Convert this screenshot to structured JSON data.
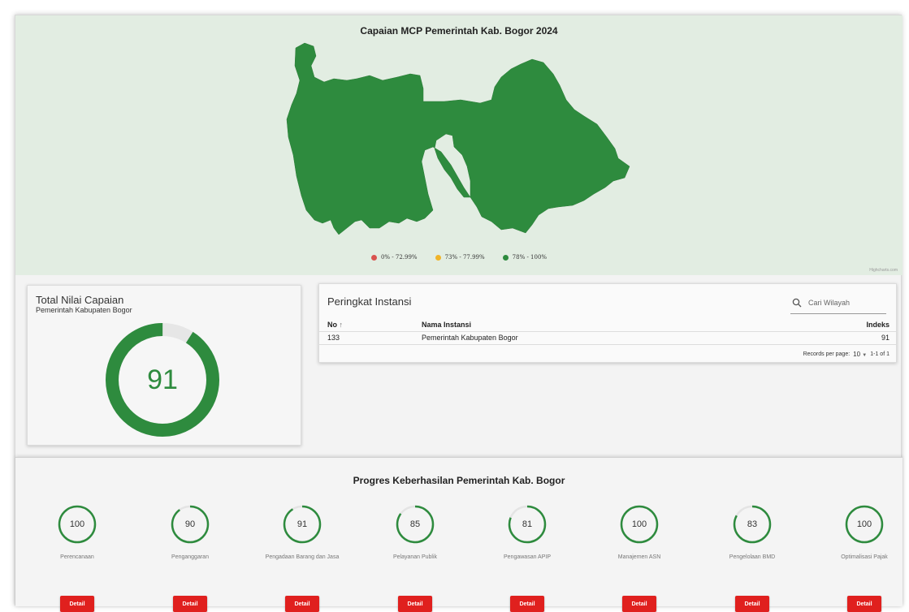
{
  "map": {
    "title": "Capaian MCP Pemerintah Kab. Bogor 2024",
    "legend": [
      {
        "label": "0% - 72.99%",
        "color": "#d9534f"
      },
      {
        "label": "73% - 77.99%",
        "color": "#f0b429"
      },
      {
        "label": "78% - 100%",
        "color": "#2e8b3e"
      }
    ],
    "region_color": "#2e8b3e",
    "credits": "Highcharts.com"
  },
  "total": {
    "title": "Total Nilai Capaian",
    "subtitle": "Pemerintah Kabupaten Bogor",
    "value": "91",
    "fraction": 0.91,
    "color": "#2e8b3e"
  },
  "ranking": {
    "title": "Peringkat Instansi",
    "search_placeholder": "Cari Wilayah",
    "columns": {
      "no": "No",
      "name": "Nama Instansi",
      "index": "Indeks"
    },
    "rows": [
      {
        "no": "133",
        "name": "Pemerintah Kabupaten Bogor",
        "index": "91"
      }
    ],
    "records_label": "Records per page:",
    "records_value": "10",
    "range": "1-1 of 1"
  },
  "progress": {
    "title": "Progres Keberhasilan Pemerintah Kab. Bogor",
    "button_label": "Detail",
    "items": [
      {
        "value": "100",
        "label": "Perencanaan",
        "fraction": 1.0
      },
      {
        "value": "90",
        "label": "Penganggaran",
        "fraction": 0.9
      },
      {
        "value": "91",
        "label": "Pengadaan Barang dan Jasa",
        "fraction": 0.91
      },
      {
        "value": "85",
        "label": "Pelayanan Publik",
        "fraction": 0.85
      },
      {
        "value": "81",
        "label": "Pengawasan APIP",
        "fraction": 0.81
      },
      {
        "value": "100",
        "label": "Manajemen ASN",
        "fraction": 1.0
      },
      {
        "value": "83",
        "label": "Pengelolaan BMD",
        "fraction": 0.83
      },
      {
        "value": "100",
        "label": "Optimalisasi Pajak",
        "fraction": 1.0
      }
    ]
  }
}
